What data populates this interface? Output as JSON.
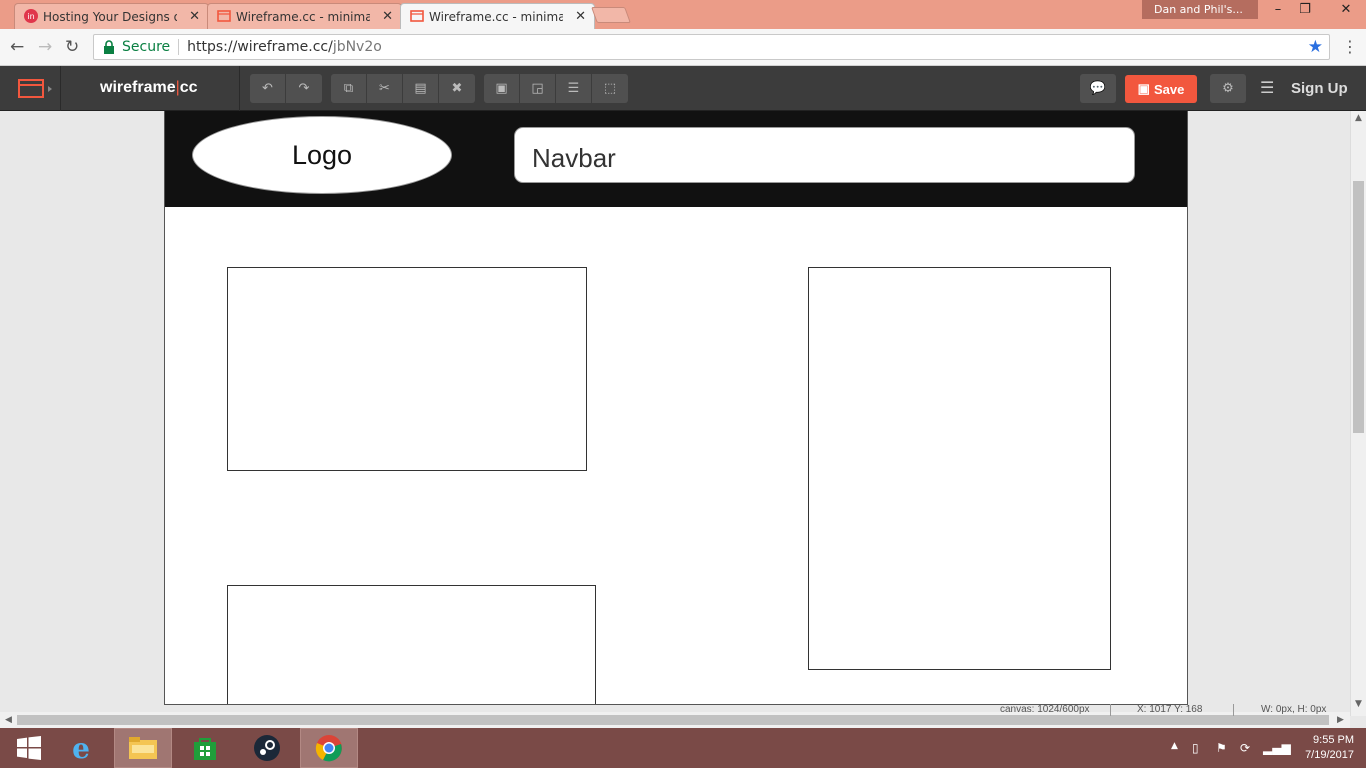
{
  "browser": {
    "tabs": [
      {
        "label": "Hosting Your Designs on",
        "active": false
      },
      {
        "label": "Wireframe.cc - minimal w",
        "active": false
      },
      {
        "label": "Wireframe.cc - minimal w",
        "active": true
      }
    ],
    "profile_name": "Dan and Phil's...",
    "secure_label": "Secure",
    "url_host": "https://wireframe.cc/",
    "url_path": "jbNv2o"
  },
  "app": {
    "brand": "wireframe",
    "brand_sep": "|",
    "brand_suffix": "cc",
    "save_label": "Save",
    "signup_label": "Sign Up",
    "accent_color": "#f2573e"
  },
  "canvas": {
    "logo_label": "Logo",
    "navbar_label": "Navbar"
  },
  "status": {
    "canvas_size": "canvas: 1024/600px",
    "cursor": "X: 1017 Y: 168",
    "selection": "W: 0px, H: 0px"
  },
  "taskbar": {
    "time": "9:55 PM",
    "date": "7/19/2017"
  }
}
